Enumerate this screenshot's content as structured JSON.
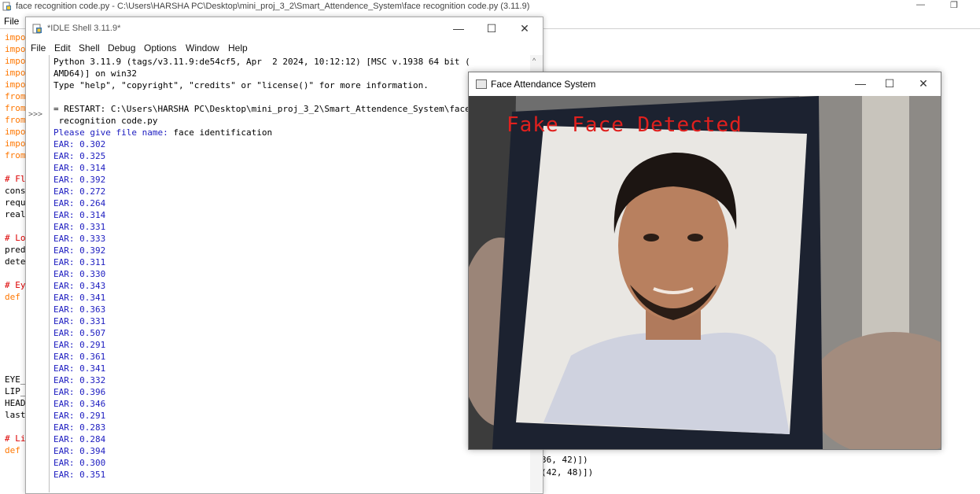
{
  "editor": {
    "title": "face recognition code.py - C:\\Users\\HARSHA PC\\Desktop\\mini_proj_3_2\\Smart_Attendence_System\\face recognition code.py (3.11.9)",
    "menu_file": "File",
    "minimize_glyph": "—",
    "restore_glyph": "❐",
    "left_code": [
      {
        "text": "impo",
        "color": "orange"
      },
      {
        "text": "impo",
        "color": "orange"
      },
      {
        "text": "impo",
        "color": "orange"
      },
      {
        "text": "impo",
        "color": "orange"
      },
      {
        "text": "impo",
        "color": "orange"
      },
      {
        "text": "from",
        "color": "orange"
      },
      {
        "text": "from",
        "color": "orange"
      },
      {
        "text": "from",
        "color": "orange"
      },
      {
        "text": "impo",
        "color": "orange"
      },
      {
        "text": "impo",
        "color": "orange"
      },
      {
        "text": "from",
        "color": "orange"
      },
      {
        "text": "",
        "color": "black"
      },
      {
        "text": "# Fl",
        "color": "red"
      },
      {
        "text": "cons",
        "color": "black"
      },
      {
        "text": "requ",
        "color": "black"
      },
      {
        "text": "real",
        "color": "black"
      },
      {
        "text": "",
        "color": "black"
      },
      {
        "text": "# Lo",
        "color": "red"
      },
      {
        "text": "pred",
        "color": "black"
      },
      {
        "text": "dete",
        "color": "black"
      },
      {
        "text": "",
        "color": "black"
      },
      {
        "text": "# Ey",
        "color": "red"
      },
      {
        "text": "def ",
        "color": "orange"
      }
    ],
    "left_code_lower": [
      {
        "text": "EYE_",
        "color": "black"
      },
      {
        "text": "LIP_",
        "color": "black"
      },
      {
        "text": "HEAD",
        "color": "black"
      },
      {
        "text": "last",
        "color": "black"
      },
      {
        "text": "",
        "color": "black"
      },
      {
        "text": "# Li",
        "color": "red"
      },
      {
        "text": "def ",
        "color": "orange"
      }
    ],
    "right_code": [
      "36, 42)])",
      "(42, 48)])"
    ]
  },
  "idle": {
    "title": "*IDLE Shell 3.11.9*",
    "menu": [
      "File",
      "Edit",
      "Shell",
      "Debug",
      "Options",
      "Window",
      "Help"
    ],
    "minimize_glyph": "—",
    "maximize_glyph": "☐",
    "close_glyph": "✕",
    "prompt": ">>>",
    "banner_line1": "Python 3.11.9 (tags/v3.11.9:de54cf5, Apr  2 2024, 10:12:12) [MSC v.1938 64 bit (",
    "banner_line2": "AMD64)] on win32",
    "banner_line3": "Type \"help\", \"copyright\", \"credits\" or \"license()\" for more information.",
    "restart_line1": "= RESTART: C:\\Users\\HARSHA PC\\Desktop\\mini_proj_3_2\\Smart_Attendence_System\\face",
    "restart_line2": " recognition code.py",
    "input_prompt": "Please give file name:",
    "input_value": " face identification",
    "ear_values": [
      "EAR: 0.302",
      "EAR: 0.325",
      "EAR: 0.314",
      "EAR: 0.392",
      "EAR: 0.272",
      "EAR: 0.264",
      "EAR: 0.314",
      "EAR: 0.331",
      "EAR: 0.333",
      "EAR: 0.392",
      "EAR: 0.311",
      "EAR: 0.330",
      "EAR: 0.343",
      "EAR: 0.341",
      "EAR: 0.363",
      "EAR: 0.331",
      "EAR: 0.507",
      "EAR: 0.291",
      "EAR: 0.361",
      "EAR: 0.341",
      "EAR: 0.332",
      "EAR: 0.396",
      "EAR: 0.346",
      "EAR: 0.291",
      "EAR: 0.283",
      "EAR: 0.284",
      "EAR: 0.394",
      "EAR: 0.300",
      "EAR: 0.351"
    ]
  },
  "face_window": {
    "title": "Face Attendance System",
    "minimize_glyph": "—",
    "maximize_glyph": "☐",
    "close_glyph": "✕",
    "detection_label": "Fake Face Detected",
    "label_color": "#e0201e"
  }
}
